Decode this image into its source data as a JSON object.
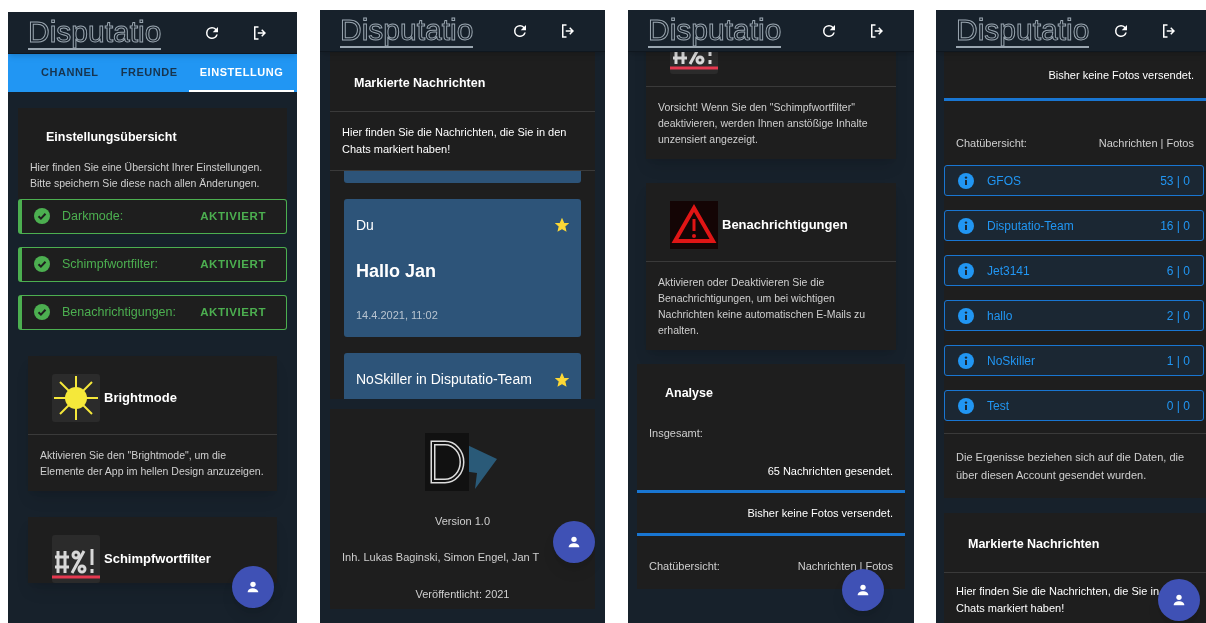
{
  "phones": [
    {
      "header": {
        "logo": "Disputatio"
      },
      "tabs": [
        {
          "label": "CHANNEL",
          "selected": false
        },
        {
          "label": "FREUNDE",
          "selected": false
        },
        {
          "label": "EINSTELLUNG",
          "selected": true
        }
      ],
      "blocks": [
        {
          "kind": "overview",
          "title": "Einstellungsübersicht",
          "text": "Hier finden Sie eine Übersicht Ihrer Einstellungen. Bitte speichern Sie diese nach allen Änderungen.",
          "settings": [
            {
              "label": "Darkmode:",
              "value": "AKTIVIERT",
              "on": true
            },
            {
              "label": "Schimpfwortfilter:",
              "value": "AKTIVIERT",
              "on": true
            },
            {
              "label": "Benachrichtigungen:",
              "value": "AKTIVIERT",
              "on": true
            }
          ]
        },
        {
          "kind": "feature",
          "title": "Brightmode",
          "text": "Aktivieren Sie den \"Brightmode\", um die Elemente der App im hellen Design anzuzeigen."
        },
        {
          "kind": "feature",
          "title": "Schimpfwortfilter"
        }
      ]
    },
    {
      "header": {
        "logo": "Disputatio"
      },
      "blocks": [
        {
          "kind": "marked",
          "title": "Markierte Nachrichten",
          "text": "Hier finden Sie die Nachrichten, die Sie in den Chats markiert haben!",
          "messages": [
            {
              "kind": "cut"
            },
            {
              "kind": "full",
              "sender": "Du",
              "text": "Hallo Jan",
              "time": "14.4.2021, 11:02",
              "starred": true
            },
            {
              "kind": "full",
              "sender": "NoSkiller in Disputatio-Team",
              "starred": true
            }
          ]
        },
        {
          "kind": "about",
          "version": "Version 1.0",
          "owners": "Inh. Lukas Baginski, Simon Engel, Jan T",
          "published": "Veröffentlicht: 2021"
        }
      ]
    },
    {
      "header": {
        "logo": "Disputatio"
      },
      "blocks": [
        {
          "kind": "feature",
          "text": "Vorsicht! Wenn Sie den \"Schimpfwortfilter\" deaktivieren, werden Ihnen anstößige Inhalte unzensiert angezeigt."
        },
        {
          "kind": "feature",
          "title": "Benachrichtigungen",
          "text": "Aktivieren oder Deaktivieren Sie die Benachrichtigungen, um bei wichtigen Nachrichten keine automatischen E-Mails zu erhalten."
        },
        {
          "kind": "analysis",
          "title": "Analyse",
          "total_label": "Insgesamt:",
          "messages": "65 Nachrichten gesendet.",
          "photos": "Bisher keine Fotos versendet.",
          "chat_label": "Chatübersicht:",
          "chat_columns": "Nachrichten | Fotos"
        }
      ]
    },
    {
      "header": {
        "logo": "Disputatio"
      },
      "blocks": [
        {
          "kind": "analysis",
          "photos": "Bisher keine Fotos versendet.",
          "chat_label": "Chatübersicht:",
          "chat_columns": "Nachrichten | Fotos",
          "chats": [
            {
              "name": "GFOS",
              "counts": "53 | 0"
            },
            {
              "name": "Disputatio-Team",
              "counts": "16 | 0"
            },
            {
              "name": "Jet3141",
              "counts": "6 | 0"
            },
            {
              "name": "hallo",
              "counts": "2 | 0"
            },
            {
              "name": "NoSkiller",
              "counts": "1 | 0"
            },
            {
              "name": "Test",
              "counts": "0 | 0"
            }
          ],
          "note": "Die Ergenisse beziehen sich auf die Daten, die über diesen Account gesendet wurden."
        },
        {
          "kind": "marked",
          "title": "Markierte Nachrichten",
          "text_lines": [
            "Hier finden Sie die Nachrichten, die Sie in",
            "Chats markiert haben!"
          ]
        }
      ]
    }
  ]
}
